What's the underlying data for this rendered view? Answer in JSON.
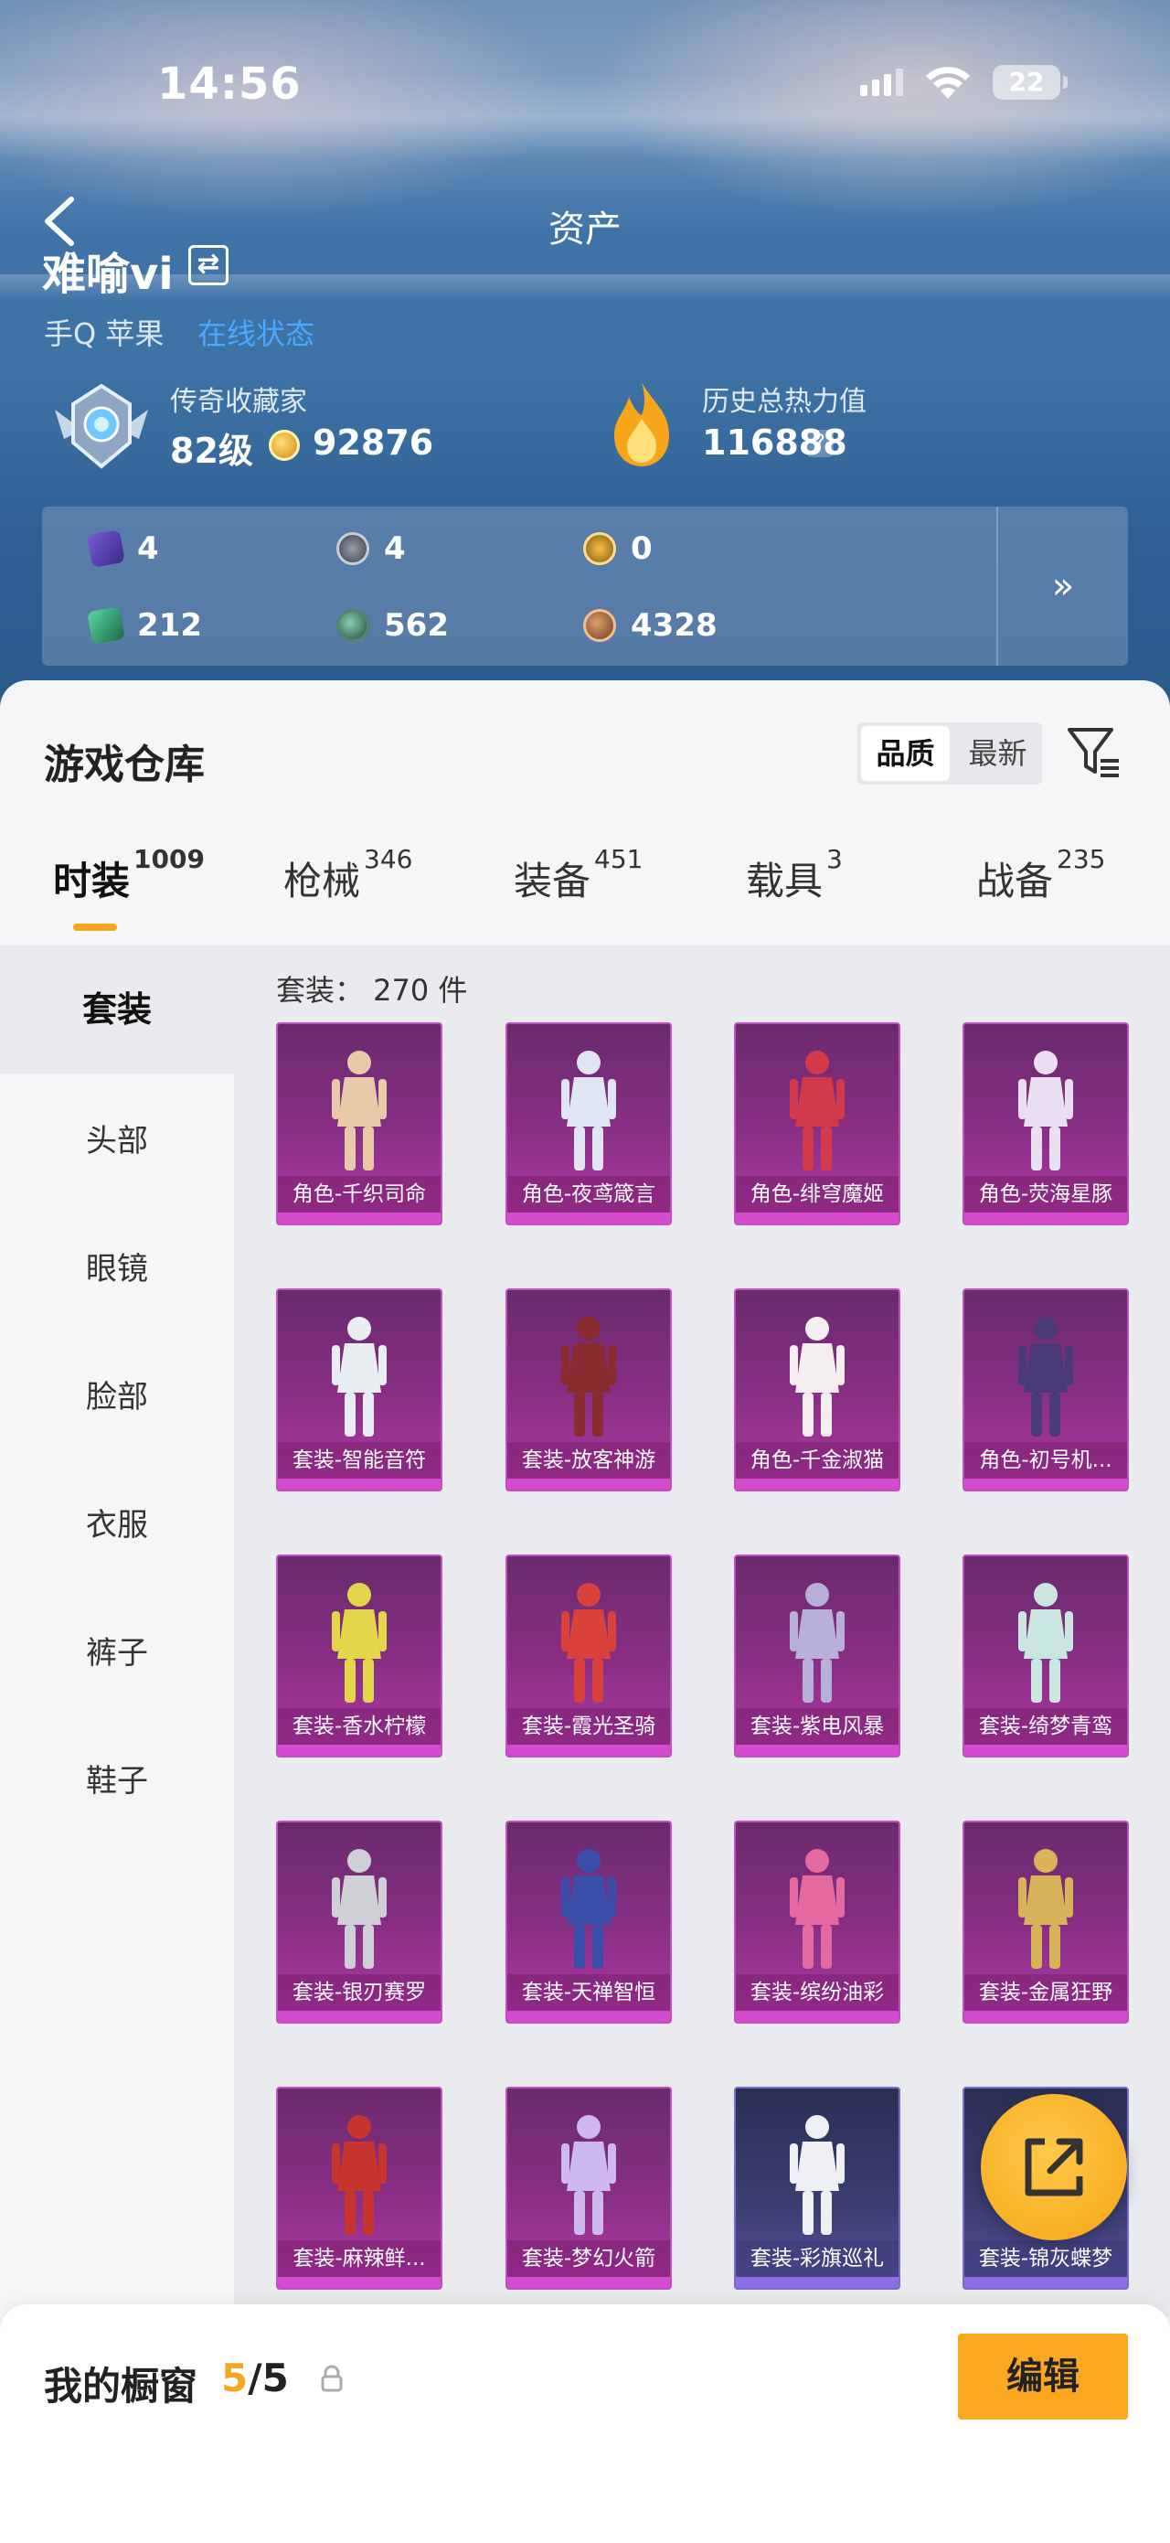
{
  "status": {
    "time": "14:56",
    "battery": "22"
  },
  "nav": {
    "title": "资产"
  },
  "user": {
    "name": "难喻vi",
    "platform": "手Q 苹果",
    "online_status": "在线状态"
  },
  "collector": {
    "title": "传奇收藏家",
    "level": "82级",
    "coins": "92876"
  },
  "heat": {
    "title": "历史总热力值",
    "value": "116888",
    "help": "?"
  },
  "currencies": [
    {
      "icon": "purple-card-icon",
      "value": "4"
    },
    {
      "icon": "silver-coin-icon",
      "value": "4"
    },
    {
      "icon": "gold-coin-icon",
      "value": "0"
    },
    {
      "icon": "green-card-icon",
      "value": "212"
    },
    {
      "icon": "green-orb-icon",
      "value": "562"
    },
    {
      "icon": "bronze-coin-icon",
      "value": "4328"
    }
  ],
  "expand_label": "»",
  "warehouse": {
    "title": "游戏仓库",
    "sort": {
      "quality": "品质",
      "latest": "最新"
    },
    "tabs": [
      {
        "label": "时装",
        "count": "1009"
      },
      {
        "label": "枪械",
        "count": "346"
      },
      {
        "label": "装备",
        "count": "451"
      },
      {
        "label": "载具",
        "count": "3"
      },
      {
        "label": "战备",
        "count": "235"
      }
    ],
    "side": [
      "套装",
      "头部",
      "眼镜",
      "脸部",
      "衣服",
      "裤子",
      "鞋子"
    ],
    "count_label": "套装：  270 件",
    "items": [
      {
        "label": "角色-千织司命",
        "style": "purple",
        "accent": "#e8c9a8"
      },
      {
        "label": "角色-夜鸢箴言",
        "style": "purple",
        "accent": "#dfe6f2"
      },
      {
        "label": "角色-绯穹魔姬",
        "style": "purple",
        "accent": "#d23a4a"
      },
      {
        "label": "角色-荧海星豚",
        "style": "purple",
        "accent": "#eadff0"
      },
      {
        "label": "套装-智能音符",
        "style": "purple",
        "accent": "#e9eef3"
      },
      {
        "label": "套装-放客神游",
        "style": "purple",
        "accent": "#8a2b2f"
      },
      {
        "label": "角色-千金淑猫",
        "style": "purple",
        "accent": "#f4eef0"
      },
      {
        "label": "角色-初号机...",
        "style": "purple",
        "accent": "#4b3a7a"
      },
      {
        "label": "套装-香水柠檬",
        "style": "purple",
        "accent": "#e3d64a"
      },
      {
        "label": "套装-霞光圣骑",
        "style": "purple",
        "accent": "#d9413a"
      },
      {
        "label": "套装-紫电风暴",
        "style": "purple",
        "accent": "#b7b0d8"
      },
      {
        "label": "套装-绮梦青鸾",
        "style": "purple",
        "accent": "#c9e6e0"
      },
      {
        "label": "套装-银刃赛罗",
        "style": "purple",
        "accent": "#cfcfd6"
      },
      {
        "label": "套装-天禅智恒",
        "style": "purple",
        "accent": "#3a4da8"
      },
      {
        "label": "套装-缤纷油彩",
        "style": "purple",
        "accent": "#e56aa0"
      },
      {
        "label": "套装-金属狂野",
        "style": "purple",
        "accent": "#d9b35a"
      },
      {
        "label": "套装-麻辣鲜...",
        "style": "purple",
        "accent": "#c8342e"
      },
      {
        "label": "套装-梦幻火箭",
        "style": "purple",
        "accent": "#cdb8ef"
      },
      {
        "label": "套装-彩旗巡礼",
        "style": "blue",
        "accent": "#eef0f4"
      },
      {
        "label": "套装-锦灰蝶梦",
        "style": "blue",
        "accent": "#6c6f88"
      }
    ]
  },
  "showcase": {
    "title": "我的橱窗",
    "current": "5",
    "sep_total": "/5",
    "edit_label": "编辑"
  }
}
